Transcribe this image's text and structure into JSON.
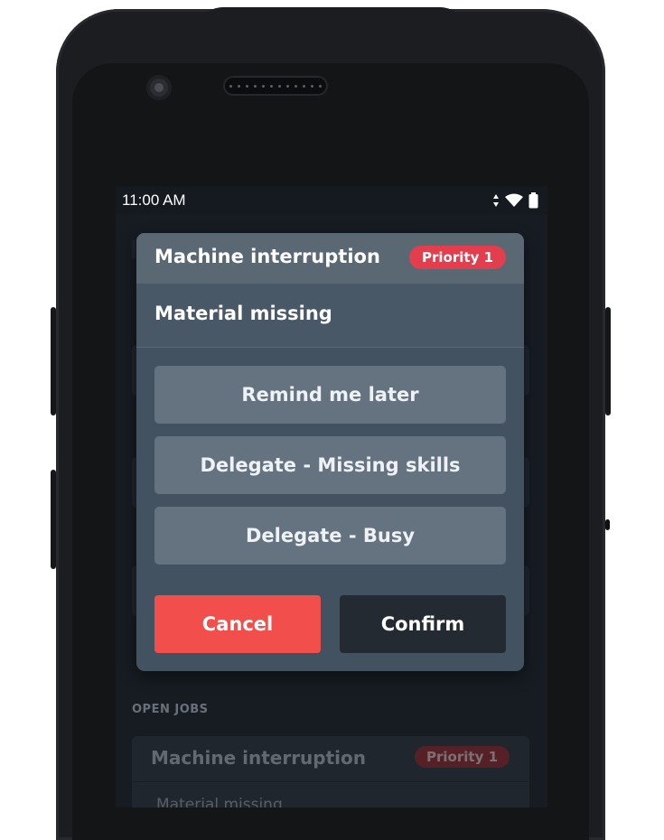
{
  "status_bar": {
    "time": "11:00 AM"
  },
  "background": {
    "open_jobs_heading": "OPEN JOBS",
    "card": {
      "title": "Machine interruption",
      "badge": "Priority 1",
      "subtitle": "Material missing"
    }
  },
  "dialog": {
    "title": "Machine interruption",
    "badge": "Priority 1",
    "subtitle": "Material missing",
    "options": [
      {
        "label": "Remind me later"
      },
      {
        "label": "Delegate - Missing skills"
      },
      {
        "label": "Delegate - Busy"
      }
    ],
    "cancel_label": "Cancel",
    "confirm_label": "Confirm"
  },
  "colors": {
    "priority_badge": "#e23e4e",
    "cancel_button": "#f24e4b",
    "confirm_button": "#242a31",
    "dialog_background": "#435260"
  }
}
